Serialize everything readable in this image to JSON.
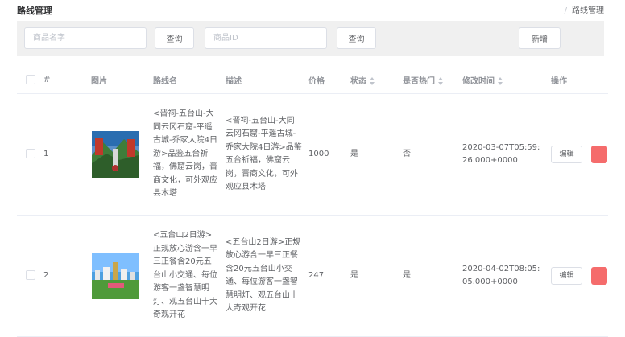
{
  "page": {
    "title": "路线管理"
  },
  "breadcrumb": {
    "separator": "/",
    "current": "路线管理"
  },
  "search": {
    "name_placeholder": "商品名字",
    "name_value": "",
    "search_label": "查询",
    "id_placeholder": "商品ID",
    "id_value": "",
    "search2_label": "查询",
    "add_label": "新增"
  },
  "table": {
    "headers": {
      "index": "#",
      "image": "图片",
      "route_name": "路线名",
      "description": "描述",
      "price": "价格",
      "status": "状态",
      "is_hot": "是否热门",
      "modified_time": "修改时间",
      "actions": "操作"
    },
    "rows": [
      {
        "index": "1",
        "route_name": "<晋祠-五台山-大同云冈石窟-平遥古城-乔家大院4日游>品鉴五台祈福，佛窟云岗，晋商文化，可外观应县木塔",
        "description": "<晋祠-五台山-大同云冈石窟-平遥古城-乔家大院4日游>品鉴五台祈福，佛窟云岗，晋商文化，可外观应县木塔",
        "price": "1000",
        "status": "是",
        "is_hot": "否",
        "modified_time": "2020-03-07T05:59:26.000+0000",
        "edit_label": "编辑"
      },
      {
        "index": "2",
        "route_name": "<五台山2日游>正规放心游含一早三正餐含20元五台山小交通、每位游客一盏智慧明灯、观五台山十大奇观开花",
        "description": "<五台山2日游>正规放心游含一早三正餐含20元五台山小交通、每位游客一盏智慧明灯、观五台山十大奇观开花",
        "price": "247",
        "status": "是",
        "is_hot": "是",
        "modified_time": "2020-04-02T08:05:05.000+0000",
        "edit_label": "编辑"
      }
    ]
  },
  "colors": {
    "toolbar_bg": "#f0f0f0",
    "danger": "#f56c6c",
    "border": "#ebeef5"
  }
}
